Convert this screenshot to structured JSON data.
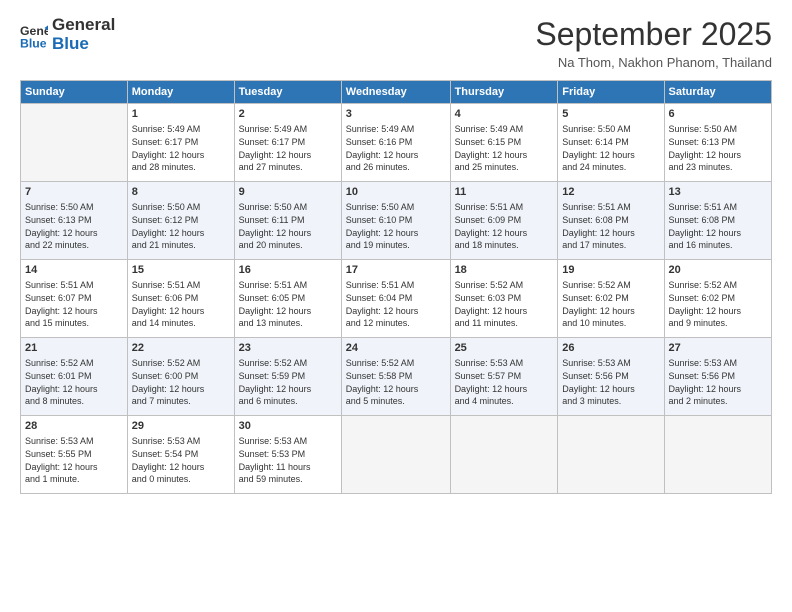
{
  "header": {
    "logo_line1": "General",
    "logo_line2": "Blue",
    "month": "September 2025",
    "location": "Na Thom, Nakhon Phanom, Thailand"
  },
  "days_of_week": [
    "Sunday",
    "Monday",
    "Tuesday",
    "Wednesday",
    "Thursday",
    "Friday",
    "Saturday"
  ],
  "weeks": [
    [
      {
        "day": "",
        "info": ""
      },
      {
        "day": "1",
        "info": "Sunrise: 5:49 AM\nSunset: 6:17 PM\nDaylight: 12 hours\nand 28 minutes."
      },
      {
        "day": "2",
        "info": "Sunrise: 5:49 AM\nSunset: 6:17 PM\nDaylight: 12 hours\nand 27 minutes."
      },
      {
        "day": "3",
        "info": "Sunrise: 5:49 AM\nSunset: 6:16 PM\nDaylight: 12 hours\nand 26 minutes."
      },
      {
        "day": "4",
        "info": "Sunrise: 5:49 AM\nSunset: 6:15 PM\nDaylight: 12 hours\nand 25 minutes."
      },
      {
        "day": "5",
        "info": "Sunrise: 5:50 AM\nSunset: 6:14 PM\nDaylight: 12 hours\nand 24 minutes."
      },
      {
        "day": "6",
        "info": "Sunrise: 5:50 AM\nSunset: 6:13 PM\nDaylight: 12 hours\nand 23 minutes."
      }
    ],
    [
      {
        "day": "7",
        "info": "Sunrise: 5:50 AM\nSunset: 6:13 PM\nDaylight: 12 hours\nand 22 minutes."
      },
      {
        "day": "8",
        "info": "Sunrise: 5:50 AM\nSunset: 6:12 PM\nDaylight: 12 hours\nand 21 minutes."
      },
      {
        "day": "9",
        "info": "Sunrise: 5:50 AM\nSunset: 6:11 PM\nDaylight: 12 hours\nand 20 minutes."
      },
      {
        "day": "10",
        "info": "Sunrise: 5:50 AM\nSunset: 6:10 PM\nDaylight: 12 hours\nand 19 minutes."
      },
      {
        "day": "11",
        "info": "Sunrise: 5:51 AM\nSunset: 6:09 PM\nDaylight: 12 hours\nand 18 minutes."
      },
      {
        "day": "12",
        "info": "Sunrise: 5:51 AM\nSunset: 6:08 PM\nDaylight: 12 hours\nand 17 minutes."
      },
      {
        "day": "13",
        "info": "Sunrise: 5:51 AM\nSunset: 6:08 PM\nDaylight: 12 hours\nand 16 minutes."
      }
    ],
    [
      {
        "day": "14",
        "info": "Sunrise: 5:51 AM\nSunset: 6:07 PM\nDaylight: 12 hours\nand 15 minutes."
      },
      {
        "day": "15",
        "info": "Sunrise: 5:51 AM\nSunset: 6:06 PM\nDaylight: 12 hours\nand 14 minutes."
      },
      {
        "day": "16",
        "info": "Sunrise: 5:51 AM\nSunset: 6:05 PM\nDaylight: 12 hours\nand 13 minutes."
      },
      {
        "day": "17",
        "info": "Sunrise: 5:51 AM\nSunset: 6:04 PM\nDaylight: 12 hours\nand 12 minutes."
      },
      {
        "day": "18",
        "info": "Sunrise: 5:52 AM\nSunset: 6:03 PM\nDaylight: 12 hours\nand 11 minutes."
      },
      {
        "day": "19",
        "info": "Sunrise: 5:52 AM\nSunset: 6:02 PM\nDaylight: 12 hours\nand 10 minutes."
      },
      {
        "day": "20",
        "info": "Sunrise: 5:52 AM\nSunset: 6:02 PM\nDaylight: 12 hours\nand 9 minutes."
      }
    ],
    [
      {
        "day": "21",
        "info": "Sunrise: 5:52 AM\nSunset: 6:01 PM\nDaylight: 12 hours\nand 8 minutes."
      },
      {
        "day": "22",
        "info": "Sunrise: 5:52 AM\nSunset: 6:00 PM\nDaylight: 12 hours\nand 7 minutes."
      },
      {
        "day": "23",
        "info": "Sunrise: 5:52 AM\nSunset: 5:59 PM\nDaylight: 12 hours\nand 6 minutes."
      },
      {
        "day": "24",
        "info": "Sunrise: 5:52 AM\nSunset: 5:58 PM\nDaylight: 12 hours\nand 5 minutes."
      },
      {
        "day": "25",
        "info": "Sunrise: 5:53 AM\nSunset: 5:57 PM\nDaylight: 12 hours\nand 4 minutes."
      },
      {
        "day": "26",
        "info": "Sunrise: 5:53 AM\nSunset: 5:56 PM\nDaylight: 12 hours\nand 3 minutes."
      },
      {
        "day": "27",
        "info": "Sunrise: 5:53 AM\nSunset: 5:56 PM\nDaylight: 12 hours\nand 2 minutes."
      }
    ],
    [
      {
        "day": "28",
        "info": "Sunrise: 5:53 AM\nSunset: 5:55 PM\nDaylight: 12 hours\nand 1 minute."
      },
      {
        "day": "29",
        "info": "Sunrise: 5:53 AM\nSunset: 5:54 PM\nDaylight: 12 hours\nand 0 minutes."
      },
      {
        "day": "30",
        "info": "Sunrise: 5:53 AM\nSunset: 5:53 PM\nDaylight: 11 hours\nand 59 minutes."
      },
      {
        "day": "",
        "info": ""
      },
      {
        "day": "",
        "info": ""
      },
      {
        "day": "",
        "info": ""
      },
      {
        "day": "",
        "info": ""
      }
    ]
  ]
}
